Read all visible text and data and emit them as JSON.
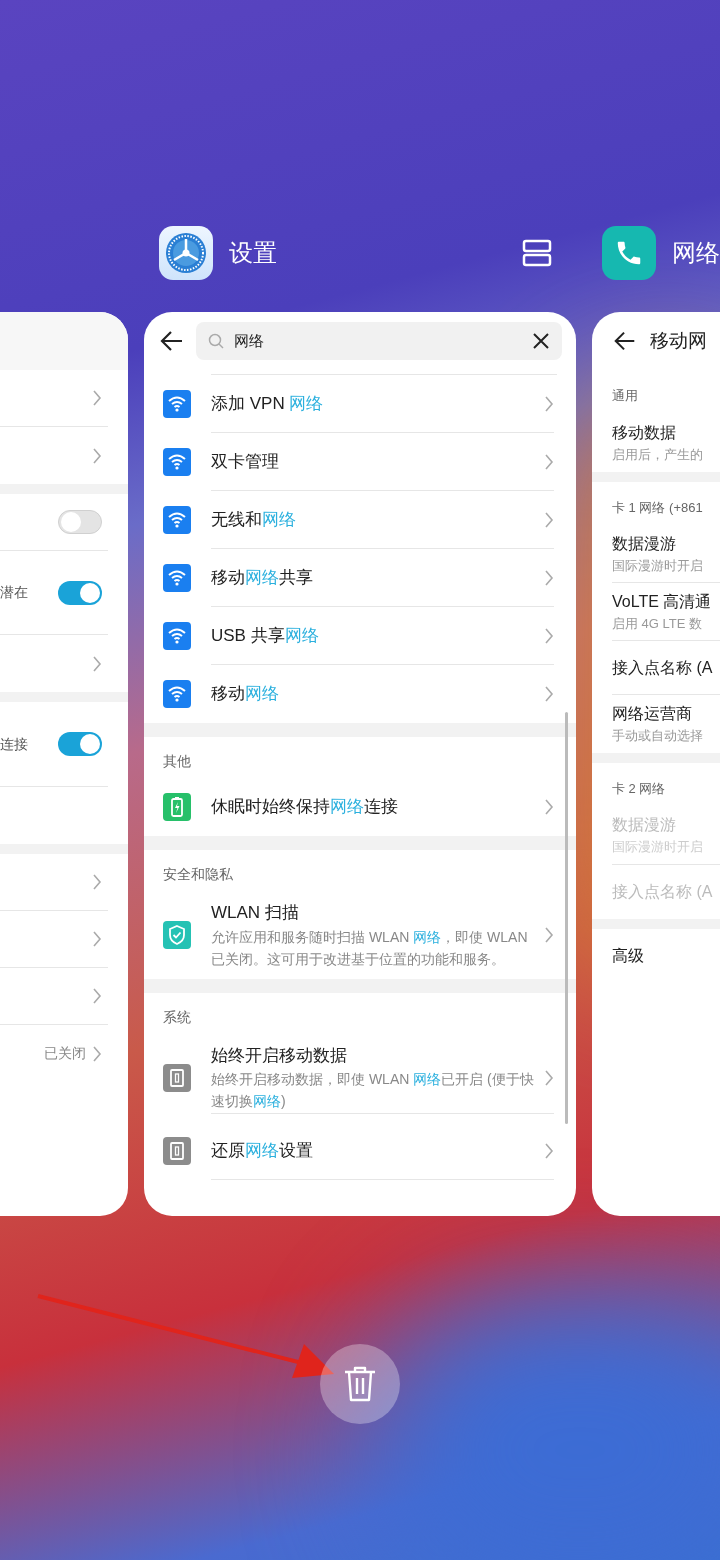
{
  "left_card": {
    "groups": [
      [
        {
          "kind": "chevron"
        },
        {
          "kind": "chevron"
        }
      ],
      [
        {
          "kind": "toggle",
          "on": false
        },
        {
          "kind": "toggle",
          "on": true,
          "text": "潜在"
        },
        {
          "kind": "chevron"
        }
      ],
      [
        {
          "kind": "toggle",
          "on": true,
          "text": "连接"
        }
      ],
      [
        {
          "kind": "chevron"
        },
        {
          "kind": "chevron"
        },
        {
          "kind": "chevron"
        },
        {
          "kind": "chevron",
          "value": "已关闭"
        }
      ]
    ]
  },
  "center_app": {
    "title": "设置"
  },
  "center_card": {
    "search": {
      "value": "网络"
    },
    "sections": [
      {
        "items": [
          {
            "kind": "wifi",
            "title": [
              {
                "text": "添加 VPN ",
                "highlight": false
              },
              {
                "text": "网络",
                "highlight": true
              }
            ]
          },
          {
            "kind": "wifi",
            "title": [
              {
                "text": "双卡管理",
                "highlight": false
              }
            ]
          },
          {
            "kind": "wifi",
            "title": [
              {
                "text": "无线和",
                "highlight": false
              },
              {
                "text": "网络",
                "highlight": true
              }
            ]
          },
          {
            "kind": "wifi",
            "title": [
              {
                "text": "移动",
                "highlight": false
              },
              {
                "text": "网络",
                "highlight": true
              },
              {
                "text": "共享",
                "highlight": false
              }
            ]
          },
          {
            "kind": "wifi",
            "title": [
              {
                "text": "USB 共享",
                "highlight": false
              },
              {
                "text": "网络",
                "highlight": true
              }
            ]
          },
          {
            "kind": "wifi",
            "title": [
              {
                "text": "移动",
                "highlight": false
              },
              {
                "text": "网络",
                "highlight": true
              }
            ]
          }
        ]
      },
      {
        "header": "其他",
        "items": [
          {
            "kind": "battery",
            "title": [
              {
                "text": "休眠时始终保持",
                "highlight": false
              },
              {
                "text": "网络",
                "highlight": true
              },
              {
                "text": "连接",
                "highlight": false
              }
            ]
          }
        ]
      },
      {
        "header": "安全和隐私",
        "items": [
          {
            "kind": "shield",
            "title": [
              {
                "text": "WLAN 扫描",
                "highlight": false
              }
            ],
            "subtitle": [
              {
                "text": "允许应用和服务随时扫描 WLAN ",
                "highlight": false
              },
              {
                "text": "网络",
                "highlight": true
              },
              {
                "text": "，即使 WLAN 已关闭。这可用于改进基于位置的功能和服务。",
                "highlight": false
              }
            ]
          }
        ]
      },
      {
        "header": "系统",
        "items": [
          {
            "kind": "sim",
            "title": [
              {
                "text": "始终开启移动数据",
                "highlight": false
              }
            ],
            "subtitle": [
              {
                "text": "始终开启移动数据，即使 WLAN ",
                "highlight": false
              },
              {
                "text": "网络",
                "highlight": true
              },
              {
                "text": "已开启 (便于快速切换",
                "highlight": false
              },
              {
                "text": "网络",
                "highlight": true
              },
              {
                "text": ")",
                "highlight": false
              }
            ]
          },
          {
            "kind": "sim",
            "title": [
              {
                "text": "还原",
                "highlight": false
              },
              {
                "text": "网络",
                "highlight": true
              },
              {
                "text": "设置",
                "highlight": false
              }
            ]
          }
        ]
      }
    ]
  },
  "right_app": {
    "title": "网络"
  },
  "right_card": {
    "title": "移动网",
    "sections": [
      {
        "header": "通用",
        "items": [
          {
            "title": "移动数据",
            "subtitle": "启用后，产生的",
            "disabled": false
          }
        ]
      },
      {
        "header": "卡 1 网络 (+861",
        "items": [
          {
            "title": "数据漫游",
            "subtitle": "国际漫游时开启",
            "disabled": false
          },
          {
            "title": "VoLTE 高清通",
            "subtitle": "启用 4G LTE 数",
            "disabled": false
          },
          {
            "title": "接入点名称 (A",
            "disabled": false
          },
          {
            "title": "网络运营商",
            "subtitle": "手动或自动选择",
            "disabled": false
          }
        ]
      },
      {
        "header": "卡 2 网络",
        "items": [
          {
            "title": "数据漫游",
            "subtitle": "国际漫游时开启",
            "disabled": true
          },
          {
            "title": "接入点名称 (A",
            "disabled": true
          }
        ]
      },
      {
        "items": [
          {
            "title": "高级",
            "disabled": false
          }
        ]
      }
    ]
  }
}
